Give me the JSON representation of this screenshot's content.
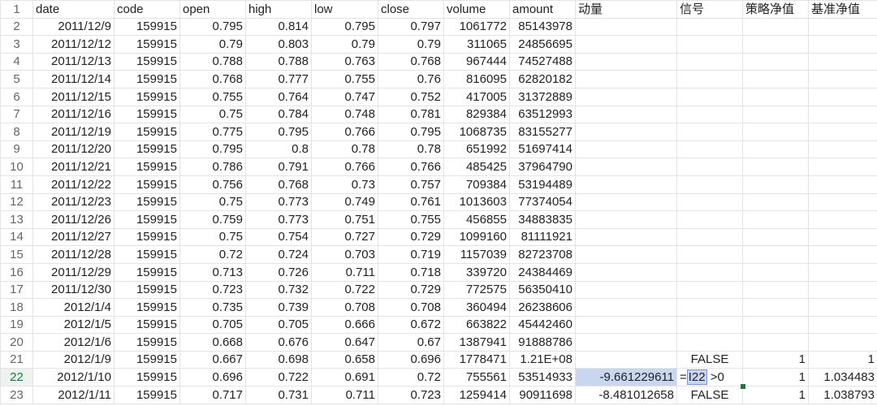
{
  "columns": {
    "date": "date",
    "code": "code",
    "open": "open",
    "high": "high",
    "low": "low",
    "close": "close",
    "volume": "volume",
    "amount": "amount",
    "momentum": "动量",
    "signal": "信号",
    "strategy_nav": "策略净值",
    "benchmark_nav": "基准净值"
  },
  "row_numbers": [
    "1",
    "2",
    "3",
    "4",
    "5",
    "6",
    "7",
    "8",
    "9",
    "10",
    "11",
    "12",
    "13",
    "14",
    "15",
    "16",
    "17",
    "18",
    "19",
    "20",
    "21",
    "22",
    "23"
  ],
  "rows": [
    {
      "date": "2011/12/9",
      "code": "159915",
      "open": "0.795",
      "high": "0.814",
      "low": "0.795",
      "close": "0.797",
      "volume": "1061772",
      "amount": "85143978"
    },
    {
      "date": "2011/12/12",
      "code": "159915",
      "open": "0.79",
      "high": "0.803",
      "low": "0.79",
      "close": "0.79",
      "volume": "311065",
      "amount": "24856695"
    },
    {
      "date": "2011/12/13",
      "code": "159915",
      "open": "0.788",
      "high": "0.788",
      "low": "0.763",
      "close": "0.768",
      "volume": "967444",
      "amount": "74527488"
    },
    {
      "date": "2011/12/14",
      "code": "159915",
      "open": "0.768",
      "high": "0.777",
      "low": "0.755",
      "close": "0.76",
      "volume": "816095",
      "amount": "62820182"
    },
    {
      "date": "2011/12/15",
      "code": "159915",
      "open": "0.755",
      "high": "0.764",
      "low": "0.747",
      "close": "0.752",
      "volume": "417005",
      "amount": "31372889"
    },
    {
      "date": "2011/12/16",
      "code": "159915",
      "open": "0.75",
      "high": "0.784",
      "low": "0.748",
      "close": "0.781",
      "volume": "829384",
      "amount": "63512993"
    },
    {
      "date": "2011/12/19",
      "code": "159915",
      "open": "0.775",
      "high": "0.795",
      "low": "0.766",
      "close": "0.795",
      "volume": "1068735",
      "amount": "83155277"
    },
    {
      "date": "2011/12/20",
      "code": "159915",
      "open": "0.795",
      "high": "0.8",
      "low": "0.78",
      "close": "0.78",
      "volume": "651992",
      "amount": "51697414"
    },
    {
      "date": "2011/12/21",
      "code": "159915",
      "open": "0.786",
      "high": "0.791",
      "low": "0.766",
      "close": "0.766",
      "volume": "485425",
      "amount": "37964790"
    },
    {
      "date": "2011/12/22",
      "code": "159915",
      "open": "0.756",
      "high": "0.768",
      "low": "0.73",
      "close": "0.757",
      "volume": "709384",
      "amount": "53194489"
    },
    {
      "date": "2011/12/23",
      "code": "159915",
      "open": "0.75",
      "high": "0.773",
      "low": "0.749",
      "close": "0.761",
      "volume": "1013603",
      "amount": "77374054"
    },
    {
      "date": "2011/12/26",
      "code": "159915",
      "open": "0.759",
      "high": "0.773",
      "low": "0.751",
      "close": "0.755",
      "volume": "456855",
      "amount": "34883835"
    },
    {
      "date": "2011/12/27",
      "code": "159915",
      "open": "0.75",
      "high": "0.754",
      "low": "0.727",
      "close": "0.729",
      "volume": "1099160",
      "amount": "81111921"
    },
    {
      "date": "2011/12/28",
      "code": "159915",
      "open": "0.72",
      "high": "0.724",
      "low": "0.703",
      "close": "0.719",
      "volume": "1157039",
      "amount": "82723708"
    },
    {
      "date": "2011/12/29",
      "code": "159915",
      "open": "0.713",
      "high": "0.726",
      "low": "0.711",
      "close": "0.718",
      "volume": "339720",
      "amount": "24384469"
    },
    {
      "date": "2011/12/30",
      "code": "159915",
      "open": "0.723",
      "high": "0.732",
      "low": "0.722",
      "close": "0.729",
      "volume": "772575",
      "amount": "56350410"
    },
    {
      "date": "2012/1/4",
      "code": "159915",
      "open": "0.735",
      "high": "0.739",
      "low": "0.708",
      "close": "0.708",
      "volume": "360494",
      "amount": "26238606"
    },
    {
      "date": "2012/1/5",
      "code": "159915",
      "open": "0.705",
      "high": "0.705",
      "low": "0.666",
      "close": "0.672",
      "volume": "663822",
      "amount": "45442460"
    },
    {
      "date": "2012/1/6",
      "code": "159915",
      "open": "0.668",
      "high": "0.676",
      "low": "0.647",
      "close": "0.67",
      "volume": "1387941",
      "amount": "91888786"
    },
    {
      "date": "2012/1/9",
      "code": "159915",
      "open": "0.667",
      "high": "0.698",
      "low": "0.658",
      "close": "0.696",
      "volume": "1778471",
      "amount": "1.21E+08",
      "momentum": "",
      "signal": "FALSE",
      "strategy_nav": "1",
      "benchmark_nav": "1"
    },
    {
      "date": "2012/1/10",
      "code": "159915",
      "open": "0.696",
      "high": "0.722",
      "low": "0.691",
      "close": "0.72",
      "volume": "755561",
      "amount": "53514933",
      "momentum": "-9.661229611",
      "formula_prefix": "=",
      "formula_ref": "I22",
      "formula_suffix": " >0",
      "strategy_nav": "1",
      "benchmark_nav": "1.034483"
    },
    {
      "date": "2012/1/11",
      "code": "159915",
      "open": "0.717",
      "high": "0.731",
      "low": "0.711",
      "close": "0.723",
      "volume": "1259414",
      "amount": "90911698",
      "momentum": "-8.481012658",
      "signal": "FALSE",
      "strategy_nav": "1",
      "benchmark_nav": "1.038793"
    }
  ]
}
